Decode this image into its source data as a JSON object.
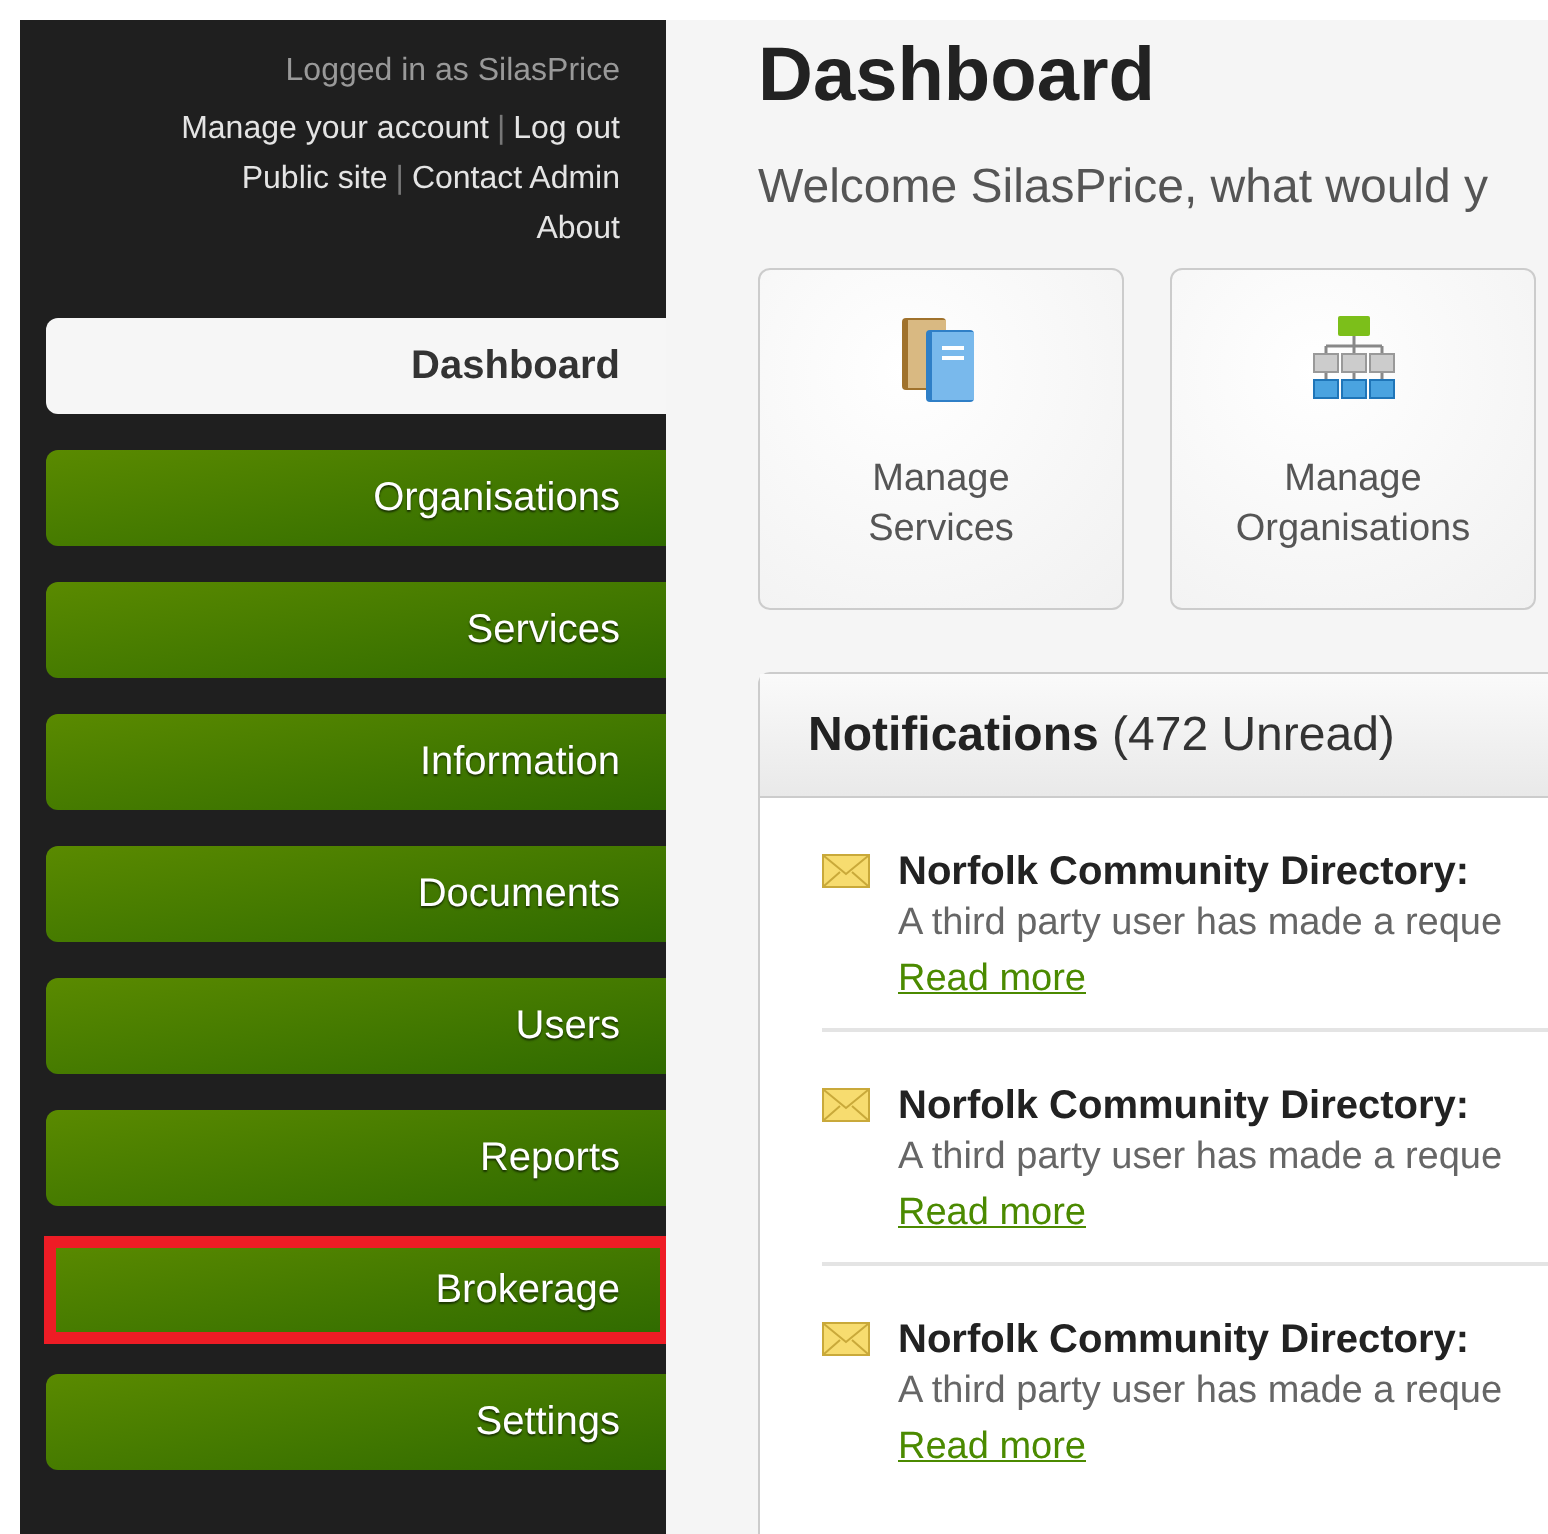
{
  "sidebar": {
    "user_line": "Logged in as SilasPrice",
    "links": [
      [
        "Manage your account",
        "Log out"
      ],
      [
        "Public site",
        "Contact Admin"
      ],
      [
        "About"
      ]
    ],
    "separator": "|",
    "items": [
      {
        "label": "Dashboard",
        "selected": true,
        "highlighted": false
      },
      {
        "label": "Organisations",
        "selected": false,
        "highlighted": false
      },
      {
        "label": "Services",
        "selected": false,
        "highlighted": false
      },
      {
        "label": "Information",
        "selected": false,
        "highlighted": false
      },
      {
        "label": "Documents",
        "selected": false,
        "highlighted": false
      },
      {
        "label": "Users",
        "selected": false,
        "highlighted": false
      },
      {
        "label": "Reports",
        "selected": false,
        "highlighted": false
      },
      {
        "label": "Brokerage",
        "selected": false,
        "highlighted": true
      },
      {
        "label": "Settings",
        "selected": false,
        "highlighted": false
      }
    ]
  },
  "main": {
    "title": "Dashboard",
    "welcome": "Welcome SilasPrice, what would y",
    "tiles": [
      {
        "kind": "books",
        "label": "Manage Services"
      },
      {
        "kind": "org",
        "label": "Manage Organisations"
      }
    ],
    "notifications": {
      "title": "Notifications",
      "count": "(472 Unread)",
      "items": [
        {
          "title": "Norfolk Community Directory:",
          "body": "A third party user has made a reque",
          "link": "Read more"
        },
        {
          "title": "Norfolk Community Directory:",
          "body": "A third party user has made a reque",
          "link": "Read more"
        },
        {
          "title": "Norfolk Community Directory:",
          "body": "A third party user has made a reque",
          "link": "Read more"
        }
      ]
    }
  }
}
